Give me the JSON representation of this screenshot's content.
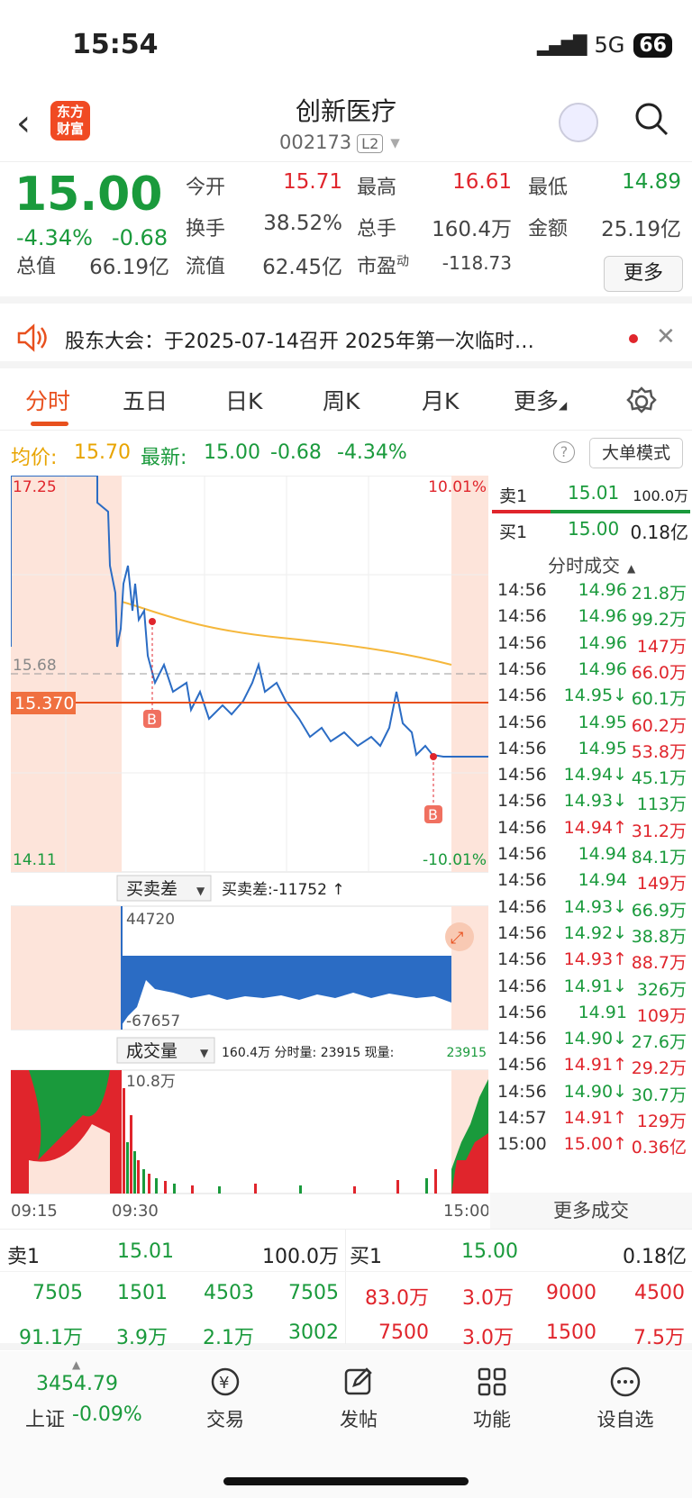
{
  "status": {
    "time": "15:54",
    "network": "5G",
    "battery": "66"
  },
  "header": {
    "title": "创新医疗",
    "code": "002173",
    "level_badge": "L2",
    "logo_text": "东方财富"
  },
  "quote": {
    "price": "15.00",
    "pct": "-4.34%",
    "change": "-0.68",
    "labels": {
      "open": "今开",
      "high": "最高",
      "low": "最低",
      "turnover": "换手",
      "volume": "总手",
      "amount": "金额",
      "mktcap": "总值",
      "float": "流值",
      "pe": "市盈"
    },
    "pe_sup": "动",
    "open": "15.71",
    "high": "16.61",
    "low": "14.89",
    "turnover": "38.52%",
    "volume": "160.4万",
    "amount": "25.19亿",
    "mktcap": "66.19亿",
    "float": "62.45亿",
    "pe": "-118.73",
    "more": "更多"
  },
  "notice": {
    "text": "股东大会：于2025-07-14召开 2025年第一次临时…"
  },
  "tabs": [
    "分时",
    "五日",
    "日K",
    "周K",
    "月K",
    "更多"
  ],
  "info": {
    "avg_label": "均价:",
    "avg": "15.70",
    "latest_label": "最新:",
    "latest": "15.00",
    "chg": "-0.68",
    "pct": "-4.34%",
    "mode_btn": "大单模式"
  },
  "chart": {
    "price_top": "17.25",
    "price_mid": "15.68",
    "price_bottom": "14.11",
    "pct_top": "10.01%",
    "pct_bottom": "-10.01%",
    "marker_price": "15.370",
    "buy_mark": "B",
    "diff_selector": "买卖差",
    "diff_label": "买卖差:-11752 ↑",
    "diff_top": "44720",
    "diff_bottom": "-67657",
    "vol_selector": "成交量",
    "vol_info": "160.4万 分时量: 23915 现量:",
    "vol_now": "23915",
    "vol_max": "10.8万",
    "time_start": "09:15",
    "time_mid": "09:30",
    "time_end": "15:00"
  },
  "chart_data": {
    "type": "line",
    "x_ticks": [
      "09:15",
      "09:30",
      "15:00"
    ],
    "ylim": [
      14.11,
      17.25
    ],
    "prev_close": 15.68,
    "avg_price": 15.7,
    "latest": 15.0
  },
  "ticks": {
    "sell1_label": "卖1",
    "sell1_price": "15.01",
    "sell1_vol": "100.0万",
    "buy1_label": "买1",
    "buy1_price": "15.00",
    "buy1_vol": "0.18亿",
    "header": "分时成交",
    "more": "更多成交",
    "rows": [
      {
        "t": "14:56",
        "p": "14.96",
        "v": "21.8万",
        "c": "g"
      },
      {
        "t": "14:56",
        "p": "14.96",
        "v": "99.2万",
        "c": "g"
      },
      {
        "t": "14:56",
        "p": "14.96",
        "v": "147万",
        "c": "r"
      },
      {
        "t": "14:56",
        "p": "14.96",
        "v": "66.0万",
        "c": "r"
      },
      {
        "t": "14:56",
        "p": "14.95↓",
        "v": "60.1万",
        "c": "g"
      },
      {
        "t": "14:56",
        "p": "14.95",
        "v": "60.2万",
        "c": "r"
      },
      {
        "t": "14:56",
        "p": "14.95",
        "v": "53.8万",
        "c": "r"
      },
      {
        "t": "14:56",
        "p": "14.94↓",
        "v": "45.1万",
        "c": "g"
      },
      {
        "t": "14:56",
        "p": "14.93↓",
        "v": "113万",
        "c": "g"
      },
      {
        "t": "14:56",
        "p": "14.94↑",
        "v": "31.2万",
        "c": "r"
      },
      {
        "t": "14:56",
        "p": "14.94",
        "v": "84.1万",
        "c": "g"
      },
      {
        "t": "14:56",
        "p": "14.94",
        "v": "149万",
        "c": "r"
      },
      {
        "t": "14:56",
        "p": "14.93↓",
        "v": "66.9万",
        "c": "g"
      },
      {
        "t": "14:56",
        "p": "14.92↓",
        "v": "38.8万",
        "c": "g"
      },
      {
        "t": "14:56",
        "p": "14.93↑",
        "v": "88.7万",
        "c": "r"
      },
      {
        "t": "14:56",
        "p": "14.91↓",
        "v": "326万",
        "c": "g"
      },
      {
        "t": "14:56",
        "p": "14.91",
        "v": "109万",
        "c": "r"
      },
      {
        "t": "14:56",
        "p": "14.90↓",
        "v": "27.6万",
        "c": "g"
      },
      {
        "t": "14:56",
        "p": "14.91↑",
        "v": "29.2万",
        "c": "r"
      },
      {
        "t": "14:56",
        "p": "14.90↓",
        "v": "30.7万",
        "c": "g"
      },
      {
        "t": "14:57",
        "p": "14.91↑",
        "v": "129万",
        "c": "r"
      },
      {
        "t": "15:00",
        "p": "15.00↑",
        "v": "0.36亿",
        "c": "r"
      }
    ]
  },
  "orderbook": {
    "sell_label": "卖1",
    "sell_price": "15.01",
    "sell_vol": "100.0万",
    "buy_label": "买1",
    "buy_price": "15.00",
    "buy_vol": "0.18亿",
    "sell_r1": [
      "7505",
      "1501",
      "4503",
      "7505"
    ],
    "sell_r2": [
      "91.1万",
      "3.9万",
      "2.1万",
      "3002"
    ],
    "buy_r1": [
      "83.0万",
      "3.0万",
      "9000",
      "4500"
    ],
    "buy_r2": [
      "7500",
      "3.0万",
      "1500",
      "7.5万"
    ]
  },
  "bottom": {
    "index_value": "3454.79",
    "index_name": "上证",
    "index_pct": "-0.09%",
    "trade": "交易",
    "post": "发帖",
    "func": "功能",
    "watch": "设自选"
  }
}
